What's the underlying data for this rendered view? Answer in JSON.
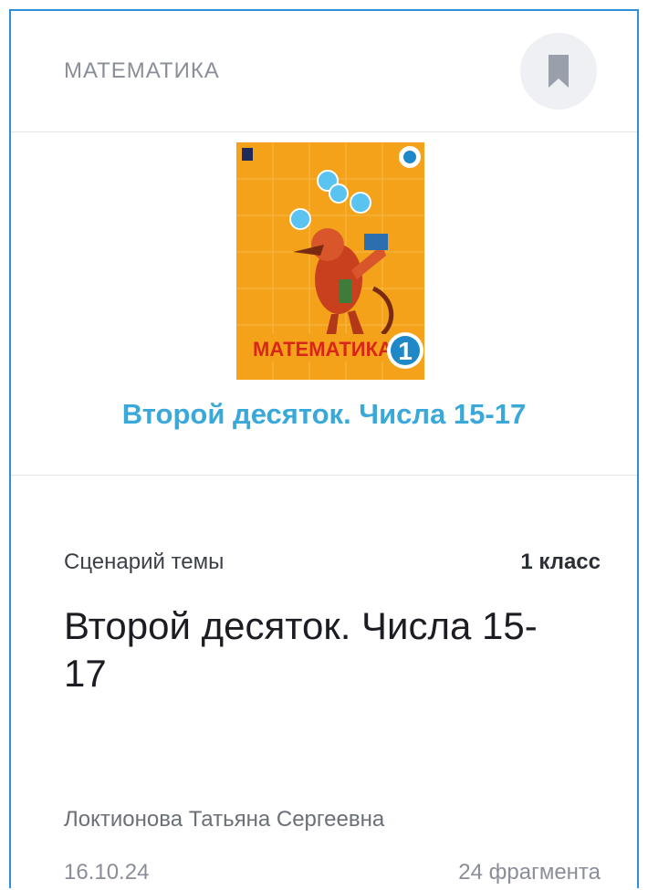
{
  "card": {
    "subject": "МАТЕМАТИКА",
    "bookmark_icon": "bookmark-icon",
    "cover": {
      "title_text": "МАТЕМАТИКА",
      "number": "1",
      "icon": "book-cover-image"
    },
    "topic_link": "Второй десяток. Числа 15-17",
    "scenario_label": "Сценарий темы",
    "grade": "1 класс",
    "topic_title": "Второй десяток. Числа 15-17",
    "author": "Локтионова Татьяна Сергеевна",
    "date": "16.10.24",
    "fragments": "24 фрагмента"
  },
  "colors": {
    "border": "#2f8fd8",
    "link": "#3aa9d9",
    "cover_bg": "#f4a21a",
    "muted": "#8a8e98"
  }
}
